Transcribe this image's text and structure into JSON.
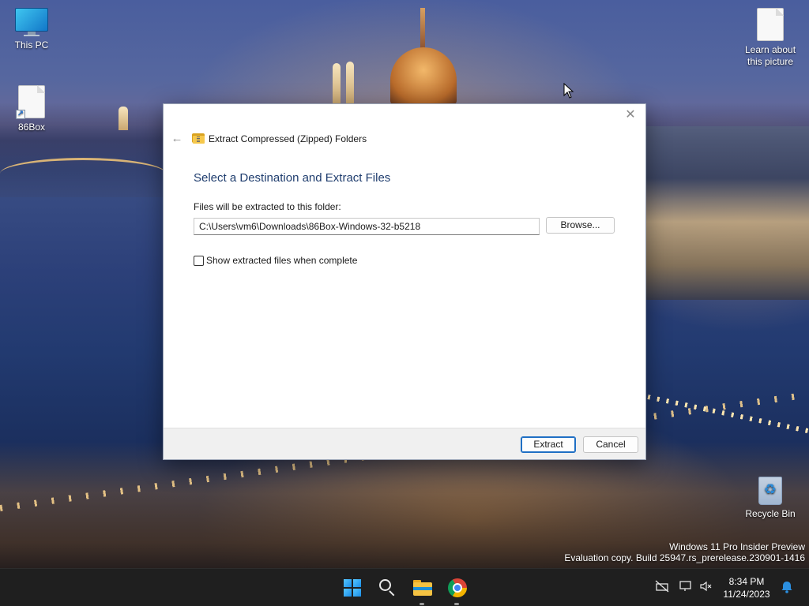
{
  "desktop": {
    "icons": [
      {
        "label": "This PC",
        "icon": "monitor-icon"
      },
      {
        "label": "86Box",
        "icon": "file-shortcut-icon"
      },
      {
        "label": "Learn about this picture",
        "icon": "file-icon"
      },
      {
        "label": "Recycle Bin",
        "icon": "recycle-bin-icon"
      }
    ],
    "watermark_line1": "Windows 11 Pro Insider Preview",
    "watermark_line2": "Evaluation copy. Build 25947.rs_prerelease.230901-1416"
  },
  "dialog": {
    "title": "Extract Compressed (Zipped) Folders",
    "heading": "Select a Destination and Extract Files",
    "folder_label": "Files will be extracted to this folder:",
    "folder_path": "C:\\Users\\vm6\\Downloads\\86Box-Windows-32-b5218",
    "browse_label": "Browse...",
    "show_files_label": "Show extracted files when complete",
    "show_files_checked": false,
    "extract_label": "Extract",
    "cancel_label": "Cancel",
    "close_glyph": "✕",
    "back_glyph": "←"
  },
  "taskbar": {
    "pinned": [
      "start-icon",
      "search-icon",
      "file-explorer-icon",
      "chrome-icon"
    ],
    "tray": [
      "network-off-icon",
      "display-icon",
      "volume-muted-icon"
    ],
    "time": "8:34 PM",
    "date": "11/24/2023",
    "accent": "#1a8ee8"
  }
}
